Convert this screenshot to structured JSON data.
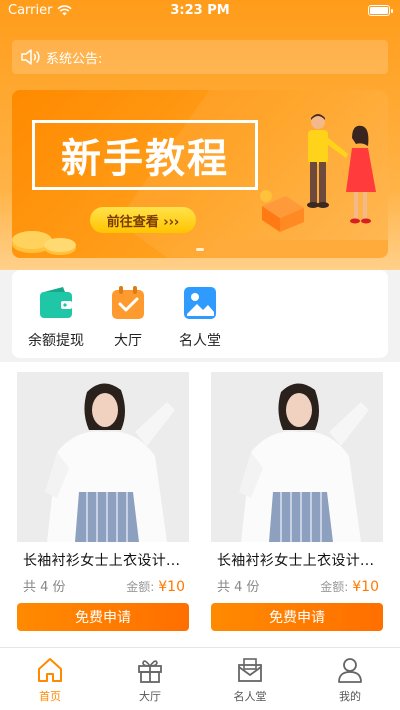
{
  "status_bar": {
    "carrier": "Carrier",
    "time": "3:23 PM"
  },
  "notice": {
    "label": "系统公告:"
  },
  "banner": {
    "title": "新手教程",
    "button": "前往查看 ›››"
  },
  "quick_menu": [
    {
      "label": "余额提现",
      "icon": "wallet-icon",
      "color": "#1fc7a6"
    },
    {
      "label": "大厅",
      "icon": "calendar-check-icon",
      "color": "#ff9a2e"
    },
    {
      "label": "名人堂",
      "icon": "image-icon",
      "color": "#2f9bff"
    }
  ],
  "products": [
    {
      "title": "长袖衬衫女士上衣设计...",
      "count": "共 4 份",
      "price_label": "金额:",
      "price": "¥10",
      "button": "免费申请"
    },
    {
      "title": "长袖衬衫女士上衣设计...",
      "count": "共 4 份",
      "price_label": "金额:",
      "price": "¥10",
      "button": "免费申请"
    }
  ],
  "tabs": [
    {
      "label": "首页",
      "icon": "home-icon",
      "active": true
    },
    {
      "label": "大厅",
      "icon": "gift-icon",
      "active": false
    },
    {
      "label": "名人堂",
      "icon": "mail-icon",
      "active": false
    },
    {
      "label": "我的",
      "icon": "user-icon",
      "active": false
    }
  ],
  "colors": {
    "accent": "#ff8a00",
    "price": "#ff7a00"
  }
}
